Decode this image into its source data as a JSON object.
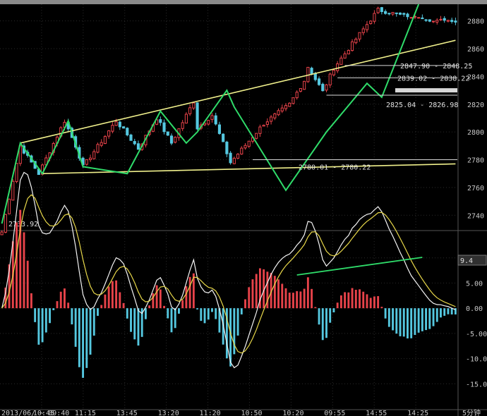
{
  "chart_data": [
    {
      "type": "candlestick",
      "ylim": [
        2730,
        2892
      ],
      "yticks": [
        "2740",
        "2760",
        "2780",
        "2800",
        "2820",
        "2840",
        "2860",
        "2880"
      ],
      "xlabels": [
        "2013/06/ ~ 09:40",
        "10:45",
        "11:15",
        "13:45",
        "13:20",
        "11:20",
        "10:50",
        "10:20",
        "09:55",
        "14:55",
        "14:25",
        "5分钟"
      ],
      "colors": {
        "up": "#e8434a",
        "down": "#55c8e0",
        "zigzag": "#2fdc6a",
        "trend": "#f0f08c",
        "grid": "#2a2a2a"
      },
      "price_labels": [
        "2733.92",
        "2847.90 - 2848.25",
        "2839.02 - 2838.22",
        "2825.04 - 2826.98",
        "2780.01 - 2780.22"
      ],
      "pivots": [
        {
          "i": 0,
          "v": 2728
        },
        {
          "i": 5,
          "v": 2790
        },
        {
          "i": 10,
          "v": 2770
        },
        {
          "i": 17,
          "v": 2808
        },
        {
          "i": 20,
          "v": 2790
        },
        {
          "i": 22,
          "v": 2775
        },
        {
          "i": 31,
          "v": 2808
        },
        {
          "i": 37,
          "v": 2788
        },
        {
          "i": 42,
          "v": 2810
        },
        {
          "i": 46,
          "v": 2792
        },
        {
          "i": 52,
          "v": 2822
        },
        {
          "i": 53,
          "v": 2803
        },
        {
          "i": 57,
          "v": 2812
        },
        {
          "i": 62,
          "v": 2778
        },
        {
          "i": 71,
          "v": 2806
        },
        {
          "i": 78,
          "v": 2820
        },
        {
          "i": 82,
          "v": 2837
        },
        {
          "i": 83,
          "v": 2847
        },
        {
          "i": 87,
          "v": 2829
        },
        {
          "i": 90,
          "v": 2846
        },
        {
          "i": 94,
          "v": 2860
        },
        {
          "i": 102,
          "v": 2888
        },
        {
          "i": 110,
          "v": 2883
        }
      ],
      "zigzag": [
        {
          "i": 0,
          "v": 2734
        },
        {
          "i": 5,
          "v": 2792
        },
        {
          "i": 11,
          "v": 2770
        },
        {
          "i": 18,
          "v": 2808
        },
        {
          "i": 22,
          "v": 2775
        },
        {
          "i": 34,
          "v": 2770
        },
        {
          "i": 43,
          "v": 2815
        },
        {
          "i": 50,
          "v": 2792
        },
        {
          "i": 53,
          "v": 2800
        },
        {
          "i": 61,
          "v": 2830
        },
        {
          "i": 63,
          "v": 2818
        },
        {
          "i": 77,
          "v": 2758
        },
        {
          "i": 88,
          "v": 2800
        },
        {
          "i": 99,
          "v": 2835
        },
        {
          "i": 103,
          "v": 2825
        },
        {
          "i": 113,
          "v": 2892
        }
      ],
      "trendlines": [
        {
          "from": {
            "i": 5,
            "v": 2792
          },
          "to": {
            "i": 123,
            "v": 2866
          }
        },
        {
          "from": {
            "i": 11,
            "v": 2770
          },
          "to": {
            "i": 123,
            "v": 2777
          }
        }
      ]
    },
    {
      "type": "macd",
      "ylim": [
        -20,
        15
      ],
      "yticks": [
        "10.00",
        "5.00",
        "0.00",
        "-5.00",
        "-10.00",
        "-15.00"
      ],
      "current_value": "9.4"
    }
  ]
}
